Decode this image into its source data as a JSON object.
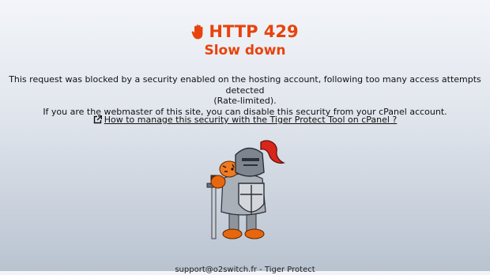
{
  "header": {
    "title": "HTTP 429",
    "subtitle": "Slow down",
    "title_icon": "raised-hand-icon",
    "accent_color": "#e8430c"
  },
  "message": {
    "line1": "This request was blocked by a security enabled on the hosting account, following too many access attempts detected",
    "line2": "(Rate-limited).",
    "line3": "If you are the webmaster of this site, you can disable this security from your cPanel account."
  },
  "help_link": {
    "icon": "external-link-icon",
    "label": "How to manage this security with the Tiger Protect Tool on cPanel ?"
  },
  "mascot": {
    "icon": "tiger-knight-mascot"
  },
  "footer": {
    "text": "support@o2switch.fr - Tiger Protect"
  }
}
